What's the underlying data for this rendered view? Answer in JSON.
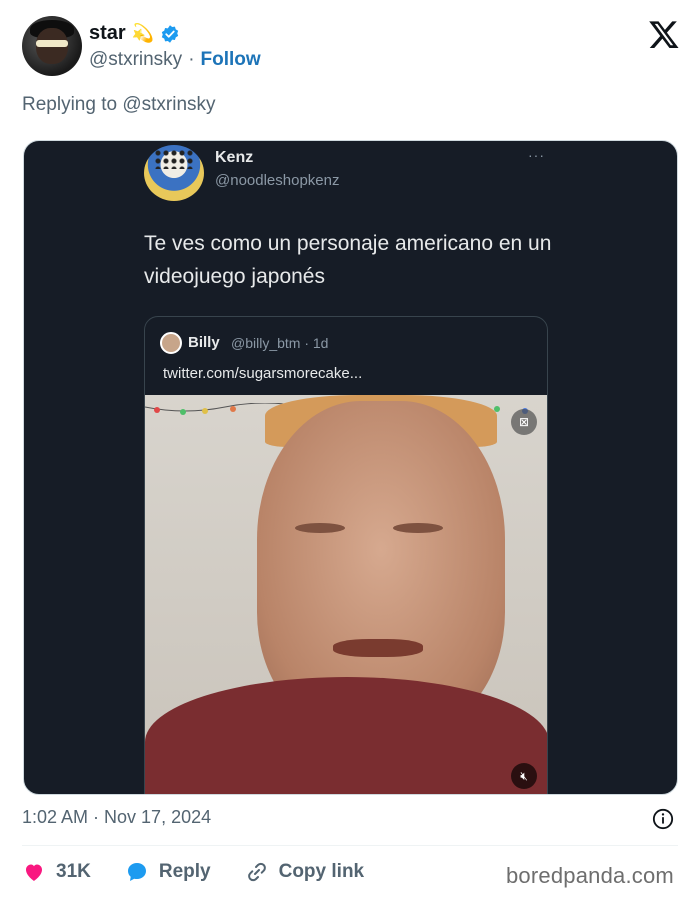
{
  "author": {
    "name": "star",
    "emoji": "💫",
    "handle": "@stxrinsky",
    "separator": "·",
    "follow_label": "Follow"
  },
  "replying_to": "Replying to @stxrinsky",
  "embedded_tweet": {
    "name": "Kenz",
    "handle": "@noodleshopkenz",
    "more": "···",
    "text": "Te ves como un personaje americano en un videojuego japonés",
    "quote": {
      "name": "Billy",
      "handle": "@billy_btm · 1d",
      "link": "twitter.com/sugarsmorecake..."
    }
  },
  "timestamp": "1:02 AM · Nov 17, 2024",
  "actions": {
    "likes": "31K",
    "reply_label": "Reply",
    "copy_label": "Copy link"
  },
  "watermark": "boredpanda.com",
  "colors": {
    "like": "#f91880",
    "reply": "#1d9bf0",
    "follow": "#1d74b8",
    "verified": "#1d9bf0"
  }
}
